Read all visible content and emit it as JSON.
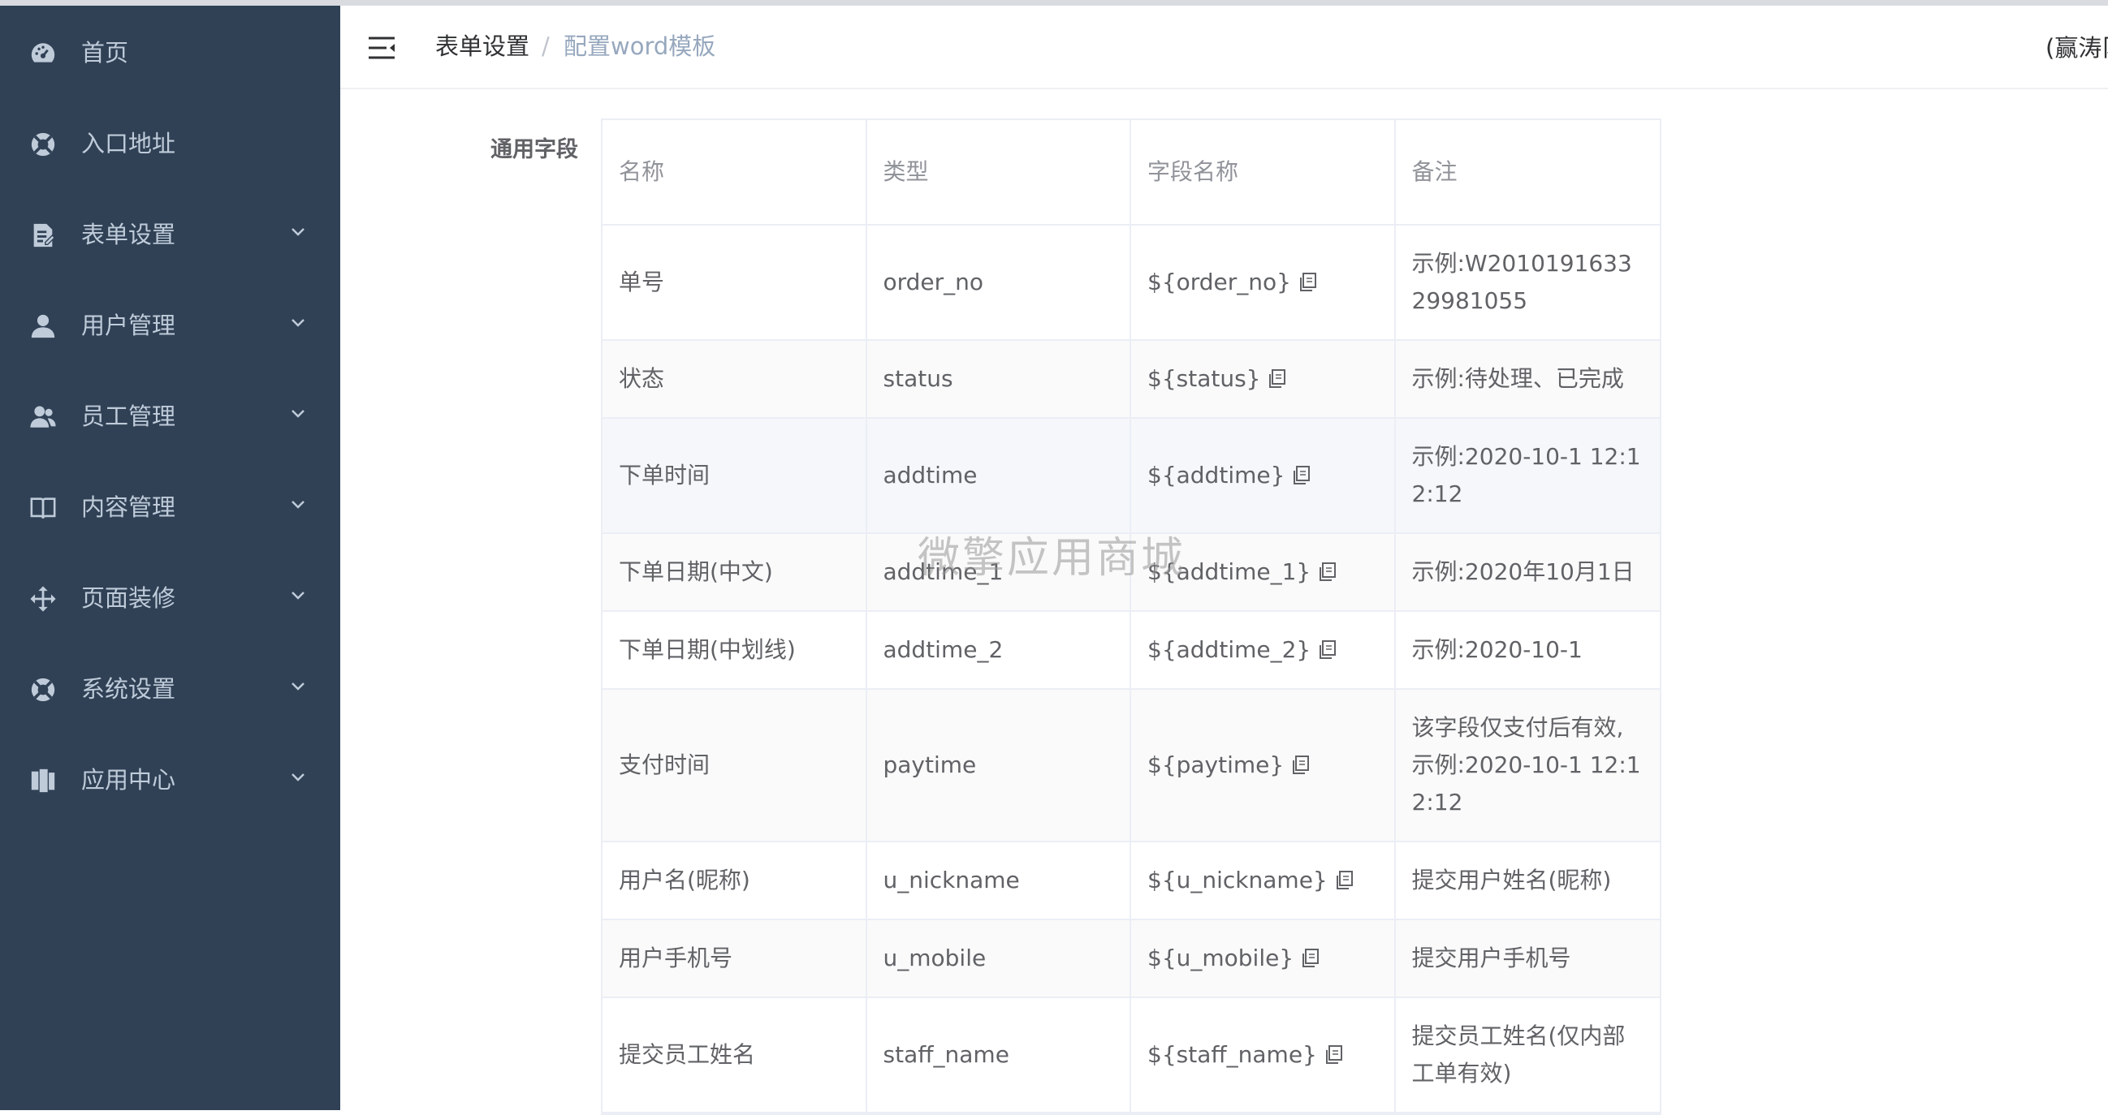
{
  "sidebar": {
    "items": [
      {
        "label": "首页",
        "icon": "dashboard-icon",
        "has_children": false
      },
      {
        "label": "入口地址",
        "icon": "lifebuoy-icon",
        "has_children": false
      },
      {
        "label": "表单设置",
        "icon": "form-icon",
        "has_children": true
      },
      {
        "label": "用户管理",
        "icon": "user-icon",
        "has_children": true
      },
      {
        "label": "员工管理",
        "icon": "users-icon",
        "has_children": true
      },
      {
        "label": "内容管理",
        "icon": "book-icon",
        "has_children": true
      },
      {
        "label": "页面装修",
        "icon": "move-icon",
        "has_children": true
      },
      {
        "label": "系统设置",
        "icon": "lifebuoy-icon",
        "has_children": true
      },
      {
        "label": "应用中心",
        "icon": "app-icon",
        "has_children": true
      }
    ]
  },
  "header": {
    "breadcrumb": [
      "表单设置",
      "配置word模板"
    ],
    "separator": "/",
    "user": "(赢涛阝"
  },
  "main": {
    "section_label": "通用字段",
    "table": {
      "headers": [
        "名称",
        "类型",
        "字段名称",
        "备注"
      ],
      "rows": [
        {
          "name": "单号",
          "type": "order_no",
          "field": "${order_no}",
          "note": "示例:W201019163329981055"
        },
        {
          "name": "状态",
          "type": "status",
          "field": "${status}",
          "note": "示例:待处理、已完成"
        },
        {
          "name": "下单时间",
          "type": "addtime",
          "field": "${addtime}",
          "note": "示例:2020-10-1 12:12:12"
        },
        {
          "name": "下单日期(中文)",
          "type": "addtime_1",
          "field": "${addtime_1}",
          "note": "示例:2020年10月1日"
        },
        {
          "name": "下单日期(中划线)",
          "type": "addtime_2",
          "field": "${addtime_2}",
          "note": "示例:2020-10-1"
        },
        {
          "name": "支付时间",
          "type": "paytime",
          "field": "${paytime}",
          "note": "该字段仅支付后有效, 示例:2020-10-1 12:12:12"
        },
        {
          "name": "用户名(昵称)",
          "type": "u_nickname",
          "field": "${u_nickname}",
          "note": "提交用户姓名(昵称)"
        },
        {
          "name": "用户手机号",
          "type": "u_mobile",
          "field": "${u_mobile}",
          "note": "提交用户手机号"
        },
        {
          "name": "提交员工姓名",
          "type": "staff_name",
          "field": "${staff_name}",
          "note": "提交员工姓名(仅内部工单有效)"
        }
      ]
    }
  },
  "watermark": "微擎应用商城",
  "colors": {
    "sidebar_bg": "#304156",
    "sidebar_text": "#bfcbd9",
    "breadcrumb_active": "#97a8be",
    "border": "#ebeef5"
  }
}
